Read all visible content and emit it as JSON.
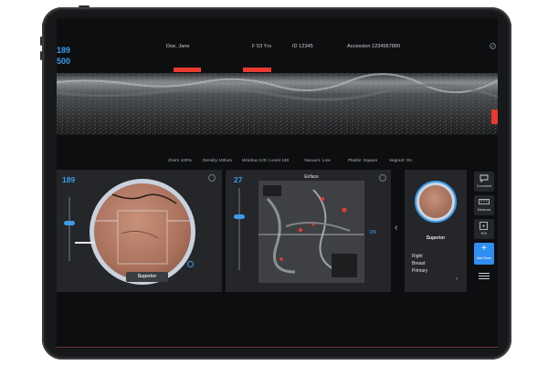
{
  "header": {
    "patient": "Doe, Jane",
    "sex_age": "F 53 Yrs",
    "id": "ID 12345",
    "accession": "Accession 1234567890",
    "depth_primary": "189",
    "depth_secondary": "500"
  },
  "toolbar": {
    "zoom": "Zoom 100%",
    "density": "Density 100um",
    "window_level": "Window 120 / Level 120",
    "vacuum": "Vacuum: Low",
    "plastic": "Plastic: Square",
    "vegtool": "Vegtool: On"
  },
  "left_panel": {
    "value": "189",
    "label": "Superior"
  },
  "center_panel": {
    "value": "27",
    "title": "Enface",
    "marker": "189"
  },
  "right_panel": {
    "label": "Superior",
    "lines": [
      "Right",
      "Breast",
      "Primary"
    ]
  },
  "sidebar": {
    "items": [
      {
        "label": "Comment",
        "icon": "comment-icon"
      },
      {
        "label": "Measure",
        "icon": "ruler-icon"
      },
      {
        "label": "ROI",
        "icon": "roi-icon"
      },
      {
        "label": "Add Scan",
        "icon": "plus-icon"
      },
      {
        "label": "",
        "icon": "hamburger-icon"
      }
    ]
  },
  "colors": {
    "accent": "#3d9be9",
    "alert": "#e83a2f",
    "panel": "#242629",
    "background": "#0d0e0f"
  }
}
